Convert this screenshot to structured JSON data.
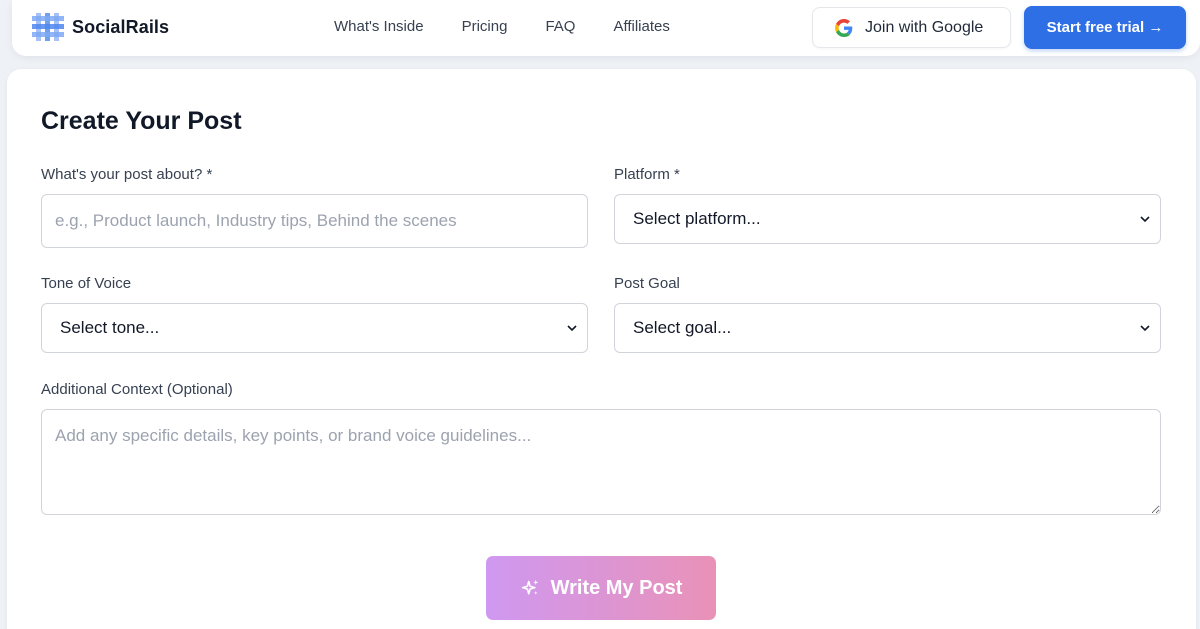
{
  "brand": {
    "name": "SocialRails",
    "logo_icon": "grid-logo-icon"
  },
  "nav": {
    "links": [
      "What's Inside",
      "Pricing",
      "FAQ",
      "Affiliates"
    ]
  },
  "auth": {
    "google_label": "Join with Google",
    "trial_label": "Start free trial →"
  },
  "form": {
    "title": "Create Your Post",
    "topic": {
      "label": "What's your post about? *",
      "placeholder": "e.g., Product launch, Industry tips, Behind the scenes",
      "value": ""
    },
    "platform": {
      "label": "Platform *",
      "selected": "Select platform..."
    },
    "tone": {
      "label": "Tone of Voice",
      "selected": "Select tone..."
    },
    "goal": {
      "label": "Post Goal",
      "selected": "Select goal..."
    },
    "context": {
      "label": "Additional Context (Optional)",
      "placeholder": "Add any specific details, key points, or brand voice guidelines...",
      "value": ""
    },
    "submit_label": "Write My Post"
  },
  "colors": {
    "accent": "#2f6fe6",
    "button_gradient_start": "#cf98f1",
    "button_gradient_end": "#e992b7"
  }
}
